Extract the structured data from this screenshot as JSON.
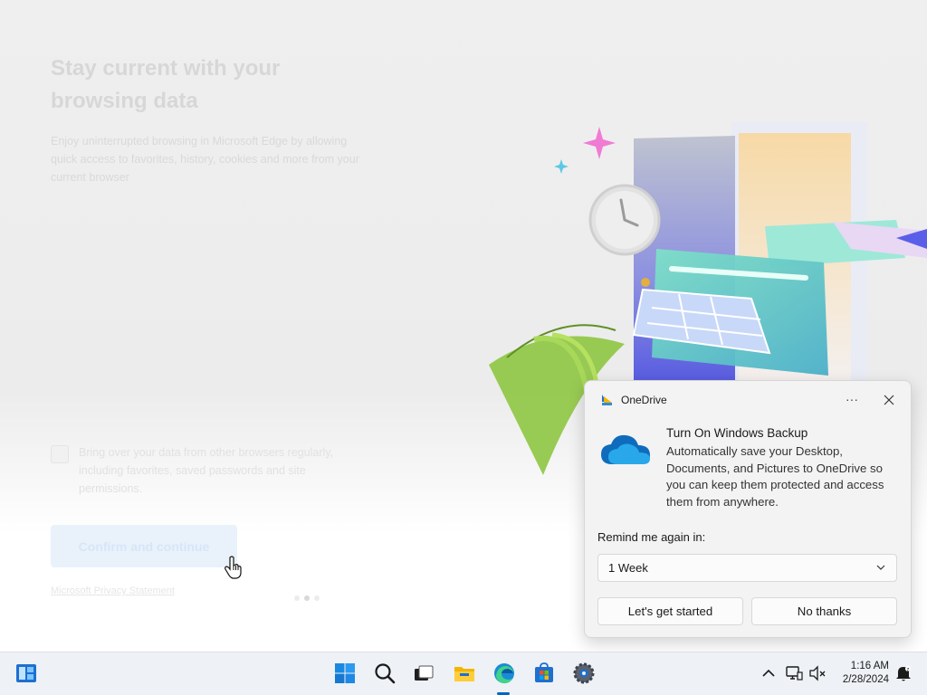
{
  "edge_setup": {
    "title": "Stay current with your browsing data",
    "description": "Enjoy uninterrupted browsing in Microsoft Edge by allowing quick access to favorites, history, cookies and more from your current browser",
    "import_checkbox_label": "Bring over your data from other browsers regularly, including favorites, saved passwords and site permissions.",
    "confirm_button": "Confirm and continue",
    "privacy_link": "Microsoft Privacy Statement"
  },
  "toast": {
    "app_name": "OneDrive",
    "more_icon": "more-horizontal-icon",
    "close_icon": "close-icon",
    "title": "Turn On Windows Backup",
    "body": "Automatically save your Desktop, Documents, and Pictures to OneDrive so you can keep them protected and access them from anywhere.",
    "remind_label": "Remind me again in:",
    "remind_selected": "1 Week",
    "primary_button": "Let's get started",
    "secondary_button": "No thanks"
  },
  "taskbar": {
    "icons": [
      "widgets-icon",
      "start-icon",
      "search-icon",
      "task-view-icon",
      "file-explorer-icon",
      "edge-icon",
      "store-icon",
      "settings-icon"
    ],
    "tray_icons": [
      "chevron-up-icon",
      "network-icon",
      "volume-muted-icon",
      "notification-icon"
    ],
    "time": "1:16 AM",
    "date": "2/28/2024"
  },
  "colors": {
    "accent": "#0067c0",
    "toast_bg": "#f3f3f3",
    "taskbar_bg": "#eef1f5"
  }
}
